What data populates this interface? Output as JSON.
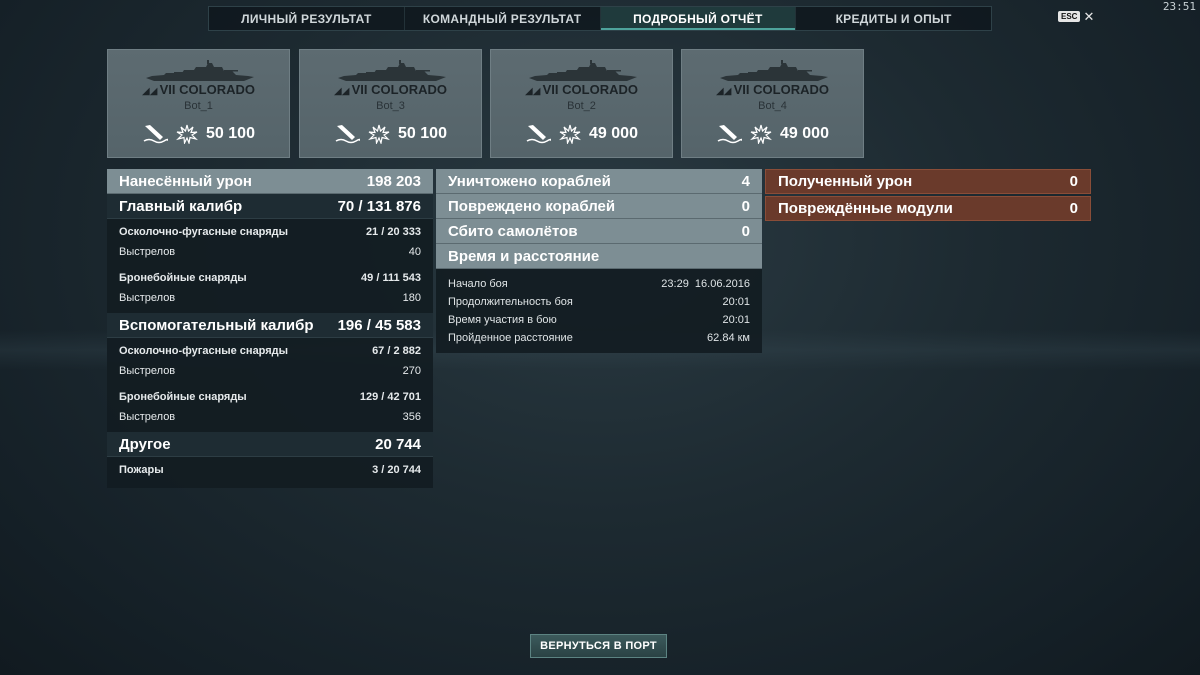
{
  "clock": "23:51",
  "tabs": [
    {
      "label": "ЛИЧНЫЙ РЕЗУЛЬТАТ"
    },
    {
      "label": "КОМАНДНЫЙ РЕЗУЛЬТАТ"
    },
    {
      "label": "ПОДРОБНЫЙ ОТЧЁТ",
      "active": true
    },
    {
      "label": "КРЕДИТЫ И ОПЫТ"
    }
  ],
  "esc_label": "ESC",
  "cards": [
    {
      "ship": "VII COLORADO",
      "player": "Bot_1",
      "damage": "50 100",
      "icons": [
        "sunk-ship-icon",
        "damage-burst-icon"
      ]
    },
    {
      "ship": "VII COLORADO",
      "player": "Bot_3",
      "damage": "50 100",
      "icons": [
        "sunk-ship-icon",
        "damage-burst-icon"
      ]
    },
    {
      "ship": "VII COLORADO",
      "player": "Bot_2",
      "damage": "49 000",
      "icons": [
        "sunk-ship-icon",
        "damage-burst-icon"
      ]
    },
    {
      "ship": "VII COLORADO",
      "player": "Bot_4",
      "damage": "49 000",
      "icons": [
        "sunk-ship-icon",
        "damage-burst-icon"
      ]
    }
  ],
  "damage": {
    "header": {
      "label": "Нанесённый урон",
      "value": "198 203"
    },
    "main": {
      "label": "Главный калибр",
      "value": "70 / 131 876",
      "he_label": "Осколочно-фугасные снаряды",
      "he_value": "21 / 20 333",
      "he_shots_label": "Выстрелов",
      "he_shots": "40",
      "ap_label": "Бронебойные снаряды",
      "ap_value": "49 / 111 543",
      "ap_shots_label": "Выстрелов",
      "ap_shots": "180"
    },
    "secondary": {
      "label": "Вспомогательный калибр",
      "value": "196 / 45 583",
      "he_label": "Осколочно-фугасные снаряды",
      "he_value": "67 / 2 882",
      "he_shots_label": "Выстрелов",
      "he_shots": "270",
      "ap_label": "Бронебойные снаряды",
      "ap_value": "129 / 42 701",
      "ap_shots_label": "Выстрелов",
      "ap_shots": "356"
    },
    "other": {
      "label": "Другое",
      "value": "20 744",
      "fires_label": "Пожары",
      "fires_value": "3 / 20 744"
    }
  },
  "combat": {
    "destroyed": {
      "label": "Уничтожено кораблей",
      "value": "4"
    },
    "damaged": {
      "label": "Повреждено кораблей",
      "value": "0"
    },
    "planes": {
      "label": "Сбито самолётов",
      "value": "0"
    },
    "time_header": "Время и расстояние",
    "start_label": "Начало боя",
    "start_value": "23:29  16.06.2016",
    "duration_label": "Продолжительность боя",
    "duration_value": "20:01",
    "participation_label": "Время участия в бою",
    "participation_value": "20:01",
    "distance_label": "Пройденное расстояние",
    "distance_value": "62.84 км"
  },
  "received": {
    "damage": {
      "label": "Полученный урон",
      "value": "0"
    },
    "modules": {
      "label": "Повреждённые модули",
      "value": "0"
    }
  },
  "return_button": "ВЕРНУТЬСЯ В ПОРТ",
  "colors": {
    "accent": "#4ea39c",
    "header_light": "#7d8e94",
    "received_red": "#6a3a2b"
  }
}
